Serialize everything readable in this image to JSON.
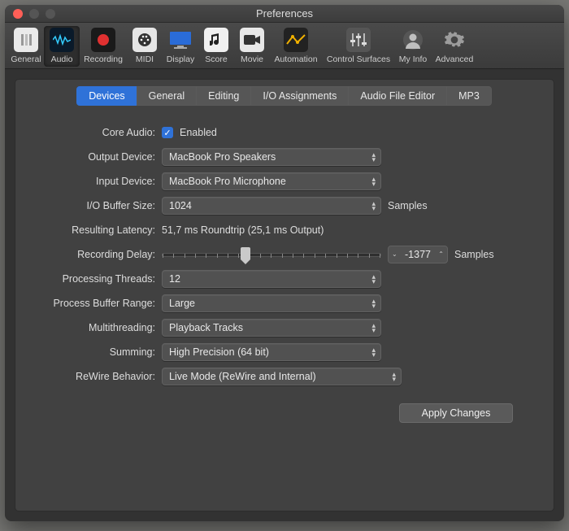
{
  "window": {
    "title": "Preferences"
  },
  "toolbar": {
    "items": [
      {
        "label": "General"
      },
      {
        "label": "Audio"
      },
      {
        "label": "Recording"
      },
      {
        "label": "MIDI"
      },
      {
        "label": "Display"
      },
      {
        "label": "Score"
      },
      {
        "label": "Movie"
      },
      {
        "label": "Automation"
      },
      {
        "label": "Control Surfaces"
      },
      {
        "label": "My Info"
      },
      {
        "label": "Advanced"
      }
    ]
  },
  "tabs": {
    "items": [
      {
        "label": "Devices"
      },
      {
        "label": "General"
      },
      {
        "label": "Editing"
      },
      {
        "label": "I/O Assignments"
      },
      {
        "label": "Audio File Editor"
      },
      {
        "label": "MP3"
      }
    ]
  },
  "form": {
    "core_audio_label": "Core Audio:",
    "core_audio_value": "Enabled",
    "output_device_label": "Output Device:",
    "output_device_value": "MacBook Pro Speakers",
    "input_device_label": "Input Device:",
    "input_device_value": "MacBook Pro Microphone",
    "io_buffer_label": "I/O Buffer Size:",
    "io_buffer_value": "1024",
    "io_buffer_suffix": "Samples",
    "latency_label": "Resulting Latency:",
    "latency_value": "51,7 ms Roundtrip (25,1 ms Output)",
    "recording_delay_label": "Recording Delay:",
    "recording_delay_value": "-1377",
    "recording_delay_suffix": "Samples",
    "processing_threads_label": "Processing Threads:",
    "processing_threads_value": "12",
    "process_buffer_label": "Process Buffer Range:",
    "process_buffer_value": "Large",
    "multithreading_label": "Multithreading:",
    "multithreading_value": "Playback Tracks",
    "summing_label": "Summing:",
    "summing_value": "High Precision (64 bit)",
    "rewire_label": "ReWire Behavior:",
    "rewire_value": "Live Mode (ReWire and Internal)",
    "apply_label": "Apply Changes"
  },
  "colors": {
    "accent": "#2f72d8"
  }
}
